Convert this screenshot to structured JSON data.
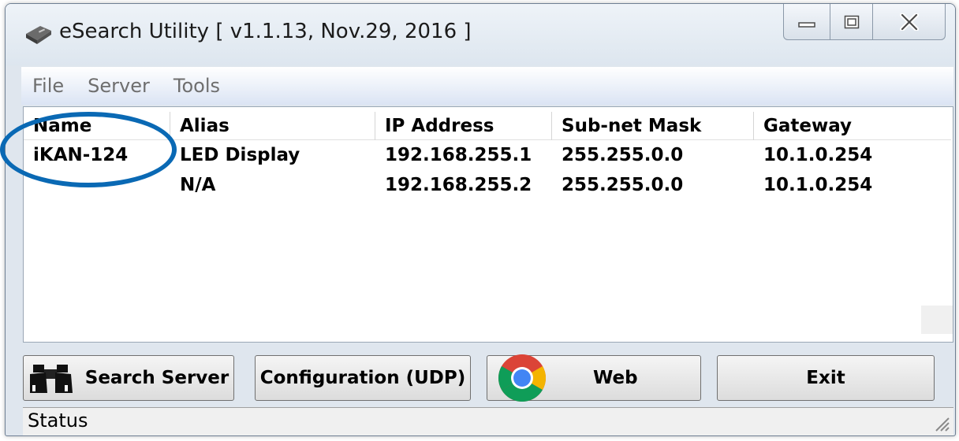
{
  "window": {
    "title": "eSearch Utility [ v1.1.13, Nov.29, 2016 ]"
  },
  "menu": {
    "items": [
      "File",
      "Server",
      "Tools"
    ]
  },
  "table": {
    "columns": [
      "Name",
      "Alias",
      "IP Address",
      "Sub-net Mask",
      "Gateway"
    ],
    "rows": [
      {
        "name": "iKAN-124",
        "alias": "LED Display",
        "ip": "192.168.255.1",
        "mask": "255.255.0.0",
        "gateway": "10.1.0.254"
      },
      {
        "name": "",
        "alias": "N/A",
        "ip": "192.168.255.2",
        "mask": "255.255.0.0",
        "gateway": "10.1.0.254"
      }
    ]
  },
  "buttons": {
    "search": "Search Server",
    "config": "Configuration (UDP)",
    "web": "Web",
    "exit": "Exit"
  },
  "status": {
    "text": "Status"
  },
  "icons": {
    "app": "network-device-icon",
    "search": "binoculars-icon",
    "web": "chrome-icon",
    "grip": "resize-grip-icon"
  },
  "colors": {
    "annotation": "#0a69b4",
    "menu_text": "#6e6e6e"
  }
}
